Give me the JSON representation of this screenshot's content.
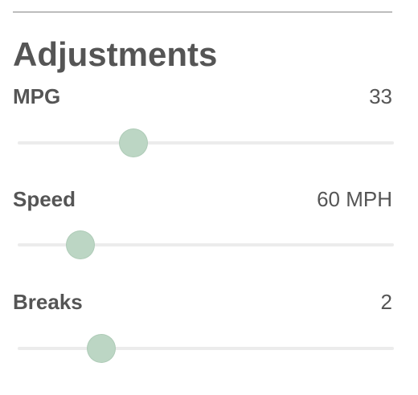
{
  "panel": {
    "title": "Adjustments"
  },
  "adjustments": [
    {
      "label": "MPG",
      "value": "33"
    },
    {
      "label": "Speed",
      "value": "60 MPH"
    },
    {
      "label": "Breaks",
      "value": "2"
    }
  ],
  "colors": {
    "thumb": "#bcd6c4",
    "track": "#ececec",
    "text": "#555555",
    "divider": "#bdbdbd"
  }
}
